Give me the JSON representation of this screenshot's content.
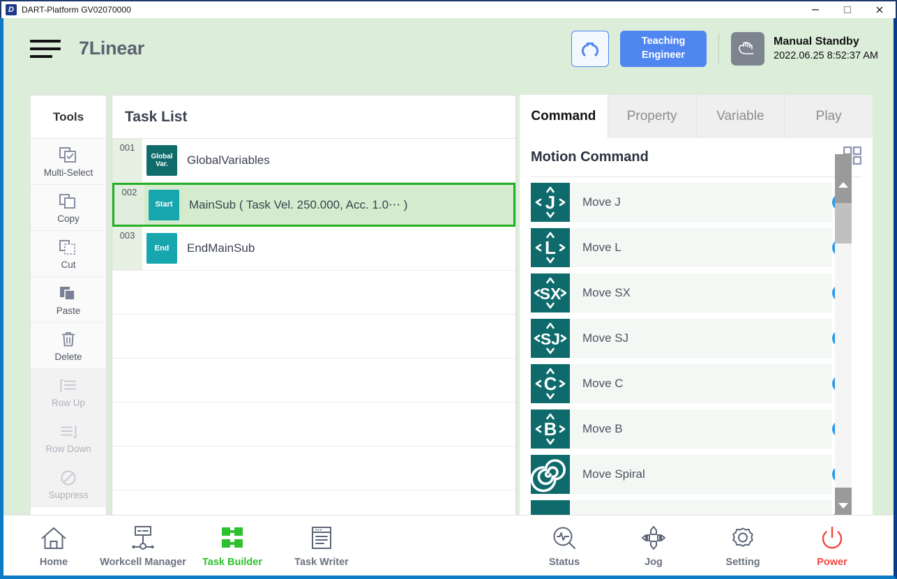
{
  "window": {
    "title": "DART-Platform GV02070000",
    "app_icon": "dart-logo-icon",
    "controls": [
      {
        "name": "minimize-button",
        "icon": "minimize-icon"
      },
      {
        "name": "maximize-button",
        "icon": "maximize-icon"
      },
      {
        "name": "close-button",
        "icon": "close-icon"
      }
    ]
  },
  "header": {
    "menu_icon": "hamburger-menu-icon",
    "project_title": "7Linear",
    "robot_button_icon": "robot-arch-icon",
    "mode_button": {
      "line1": "Teaching",
      "line2": "Engineer"
    },
    "state_icon": "manual-hand-icon",
    "state_title": "Manual Standby",
    "state_time": "2022.06.25 8:52:37 AM",
    "accent_blue": "#4f86f0",
    "header_bg": "#dcedda"
  },
  "tools": {
    "title": "Tools",
    "items": [
      {
        "label": "Multi-Select",
        "icon": "multi-select-icon",
        "disabled": false
      },
      {
        "label": "Copy",
        "icon": "copy-icon",
        "disabled": false
      },
      {
        "label": "Cut",
        "icon": "cut-icon",
        "disabled": false
      },
      {
        "label": "Paste",
        "icon": "paste-icon",
        "disabled": false
      },
      {
        "label": "Delete",
        "icon": "delete-trash-icon",
        "disabled": false
      },
      {
        "label": "Row Up",
        "icon": "row-up-icon",
        "disabled": true
      },
      {
        "label": "Row Down",
        "icon": "row-down-icon",
        "disabled": true
      },
      {
        "label": "Suppress",
        "icon": "suppress-icon",
        "disabled": true
      }
    ]
  },
  "task_list": {
    "title": "Task List",
    "selected_index": 1,
    "selection_color": "#23b023",
    "rows": [
      {
        "num": "001",
        "tag": "Global Var.",
        "tag_line1": "Global",
        "tag_line2": "Var.",
        "tag_color": "#106b6b",
        "label": "GlobalVariables"
      },
      {
        "num": "002",
        "tag": "Start",
        "tag_line1": "Start",
        "tag_line2": "",
        "tag_color": "#17a5ae",
        "label": "MainSub  ( Task Vel. 250.000, Acc. 1.0⋯ )"
      },
      {
        "num": "003",
        "tag": "End",
        "tag_line1": "End",
        "tag_line2": "",
        "tag_color": "#17a5ae",
        "label": "EndMainSub"
      }
    ],
    "empty_rows": 6
  },
  "right_panel": {
    "tabs": [
      {
        "label": "Command",
        "active": true
      },
      {
        "label": "Property",
        "active": false
      },
      {
        "label": "Variable",
        "active": false
      },
      {
        "label": "Play",
        "active": false
      }
    ],
    "section_title": "Motion Command",
    "grid_icon": "grid-view-icon",
    "info_icon": "info-icon",
    "commands": [
      {
        "label": "Move J",
        "icon": "move-j-icon",
        "glyph": "J"
      },
      {
        "label": "Move L",
        "icon": "move-l-icon",
        "glyph": "L"
      },
      {
        "label": "Move SX",
        "icon": "move-sx-icon",
        "glyph": "SX"
      },
      {
        "label": "Move SJ",
        "icon": "move-sj-icon",
        "glyph": "SJ"
      },
      {
        "label": "Move C",
        "icon": "move-c-icon",
        "glyph": "C"
      },
      {
        "label": "Move B",
        "icon": "move-b-icon",
        "glyph": "B"
      },
      {
        "label": "Move Spiral",
        "icon": "move-spiral-icon",
        "glyph": ""
      }
    ],
    "icon_color": "#0f6b6b",
    "scrollbar": {
      "up_arrow": "scroll-up-arrow-icon",
      "down_arrow": "scroll-down-arrow-icon"
    }
  },
  "bottom_nav": {
    "left": [
      {
        "label": "Home",
        "icon": "home-icon",
        "active": false
      },
      {
        "label": "Workcell Manager",
        "icon": "workcell-manager-icon",
        "active": false
      },
      {
        "label": "Task Builder",
        "icon": "task-builder-icon",
        "active": true
      },
      {
        "label": "Task Writer",
        "icon": "task-writer-icon",
        "active": false
      }
    ],
    "right": [
      {
        "label": "Status",
        "icon": "status-icon",
        "active": false
      },
      {
        "label": "Jog",
        "icon": "jog-icon",
        "active": false
      },
      {
        "label": "Setting",
        "icon": "setting-gear-icon",
        "active": false
      },
      {
        "label": "Power",
        "icon": "power-icon",
        "active": false,
        "power": true
      }
    ],
    "active_color": "#2dc12d",
    "power_color": "#f2473f"
  }
}
